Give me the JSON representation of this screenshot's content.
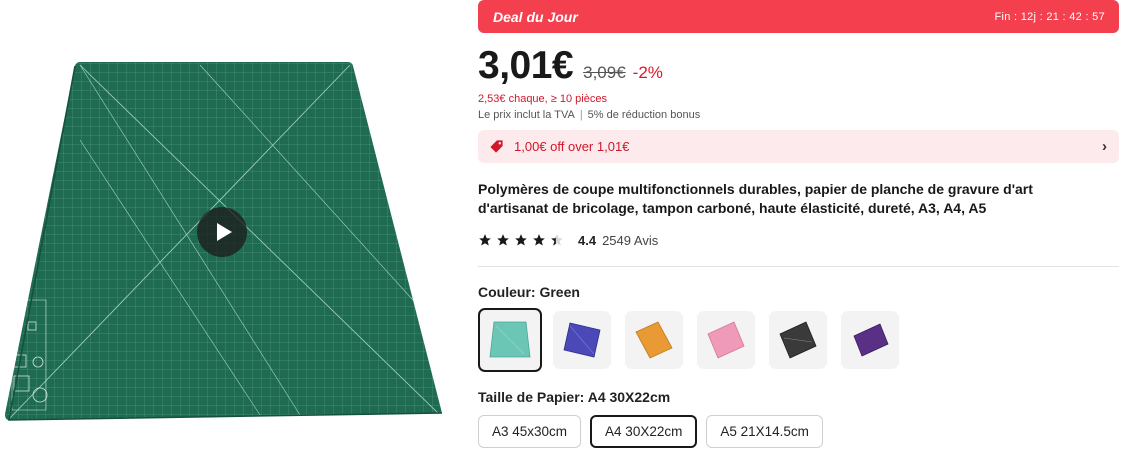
{
  "deal": {
    "title": "Deal du Jour",
    "timer": "Fin : 12j : 21 : 42 : 57",
    "color": "#f43f4f"
  },
  "price": {
    "current": "3,01€",
    "original": "3,09€",
    "discount": "-2%",
    "bulk": "2,53€ chaque, ≥ 10 pièces",
    "vat": "Le prix inclut la TVA",
    "bonus": "5% de réduction bonus"
  },
  "coupon": {
    "text": "1,00€ off over 1,01€",
    "icon": "tag-icon",
    "chevron": "›"
  },
  "product": {
    "title": "Polymères de coupe multifonctionnels durables, papier de planche de gravure d'art d'artisanat de bricolage, tampon carboné, haute élasticité, dureté, A3, A4, A5"
  },
  "rating": {
    "value": "4.4",
    "count": "2549 Avis",
    "stars": 4.4
  },
  "color_option": {
    "label": "Couleur: Green",
    "swatches": [
      {
        "name": "Green",
        "color": "#6cc6b6",
        "selected": true
      },
      {
        "name": "Blue",
        "color": "#4b48b8",
        "selected": false
      },
      {
        "name": "Orange",
        "color": "#e99a35",
        "selected": false
      },
      {
        "name": "Pink",
        "color": "#ee9ab8",
        "selected": false
      },
      {
        "name": "Black",
        "color": "#3a3a3a",
        "selected": false
      },
      {
        "name": "Purple",
        "color": "#5a2f86",
        "selected": false
      }
    ]
  },
  "size_option": {
    "label": "Taille de Papier: A4 30X22cm",
    "options": [
      "A3 45x30cm",
      "A4 30X22cm",
      "A5 21X14.5cm"
    ],
    "selected": "A4 30X22cm"
  },
  "media": {
    "mat_color": "#1f6b52",
    "play_icon": "play-icon"
  }
}
